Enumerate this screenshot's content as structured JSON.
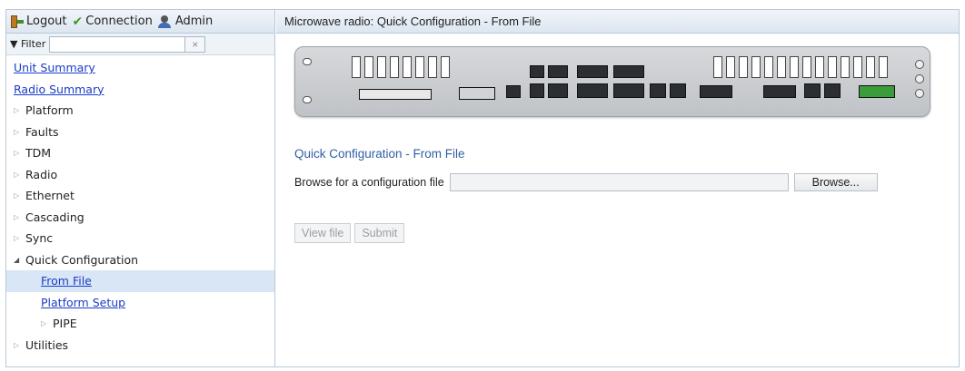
{
  "topbar": {
    "logout": "Logout",
    "connection": "Connection",
    "admin": "Admin"
  },
  "filter": {
    "label": "Filter",
    "value": "",
    "clear": "×"
  },
  "tree": {
    "unit_summary": "Unit Summary",
    "radio_summary": "Radio Summary",
    "platform": "Platform",
    "faults": "Faults",
    "tdm": "TDM",
    "radio": "Radio",
    "ethernet": "Ethernet",
    "cascading": "Cascading",
    "sync": "Sync",
    "quick_configuration": "Quick Configuration",
    "from_file": "From File",
    "platform_setup": "Platform Setup",
    "pipe": "PIPE",
    "utilities": "Utilities"
  },
  "main": {
    "header": "Microwave radio: Quick Configuration - From File",
    "section_title": "Quick Configuration - From File",
    "browse_label": "Browse for a configuration file",
    "file_value": "",
    "browse_button": "Browse...",
    "view_file_button": "View file",
    "submit_button": "Submit"
  },
  "colors": {
    "accent_blue": "#2f5fa5",
    "link_blue": "#1a3cc8",
    "selected_row": "#d9e6f5"
  }
}
